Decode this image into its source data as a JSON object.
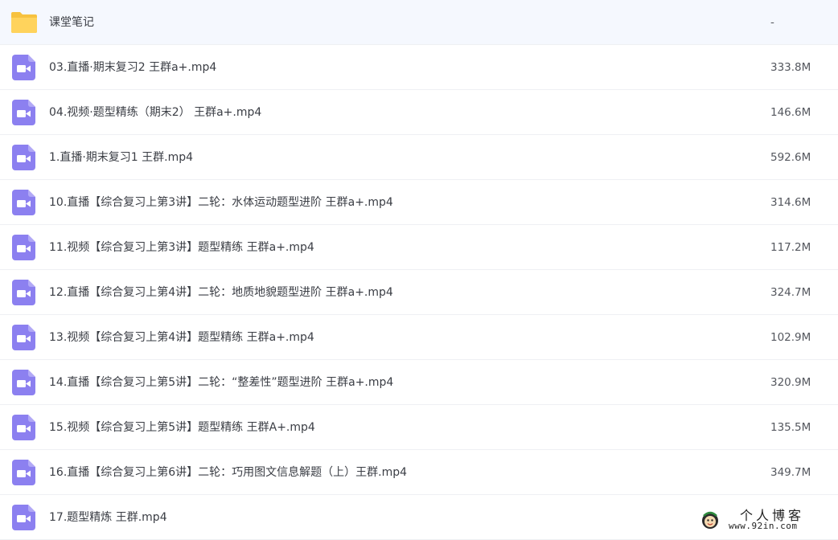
{
  "colors": {
    "folder": "#FFD35C",
    "video": "#8C80F0"
  },
  "files": [
    {
      "icon": "folder-icon",
      "name": "课堂笔记",
      "size": "-"
    },
    {
      "icon": "video-file-icon",
      "name": "03.直播·期末复习2 王群a+.mp4",
      "size": "333.8M"
    },
    {
      "icon": "video-file-icon",
      "name": "04.视频·题型精练（期末2） 王群a+.mp4",
      "size": "146.6M"
    },
    {
      "icon": "video-file-icon",
      "name": "1.直播·期末复习1 王群.mp4",
      "size": "592.6M"
    },
    {
      "icon": "video-file-icon",
      "name": "10.直播【综合复习上第3讲】二轮：水体运动题型进阶 王群a+.mp4",
      "size": "314.6M"
    },
    {
      "icon": "video-file-icon",
      "name": "11.视频【综合复习上第3讲】题型精练 王群a+.mp4",
      "size": "117.2M"
    },
    {
      "icon": "video-file-icon",
      "name": "12.直播【综合复习上第4讲】二轮：地质地貌题型进阶 王群a+.mp4",
      "size": "324.7M"
    },
    {
      "icon": "video-file-icon",
      "name": "13.视频【综合复习上第4讲】题型精练 王群a+.mp4",
      "size": "102.9M"
    },
    {
      "icon": "video-file-icon",
      "name": "14.直播【综合复习上第5讲】二轮：“整差性”题型进阶 王群a+.mp4",
      "size": "320.9M"
    },
    {
      "icon": "video-file-icon",
      "name": "15.视频【综合复习上第5讲】题型精练 王群A+.mp4",
      "size": "135.5M"
    },
    {
      "icon": "video-file-icon",
      "name": "16.直播【综合复习上第6讲】二轮：巧用图文信息解题（上）王群.mp4",
      "size": "349.7M"
    },
    {
      "icon": "video-file-icon",
      "name": "17.题型精炼 王群.mp4",
      "size": ""
    }
  ],
  "watermark": {
    "title": "个人博客",
    "url": "www.92in.com"
  }
}
